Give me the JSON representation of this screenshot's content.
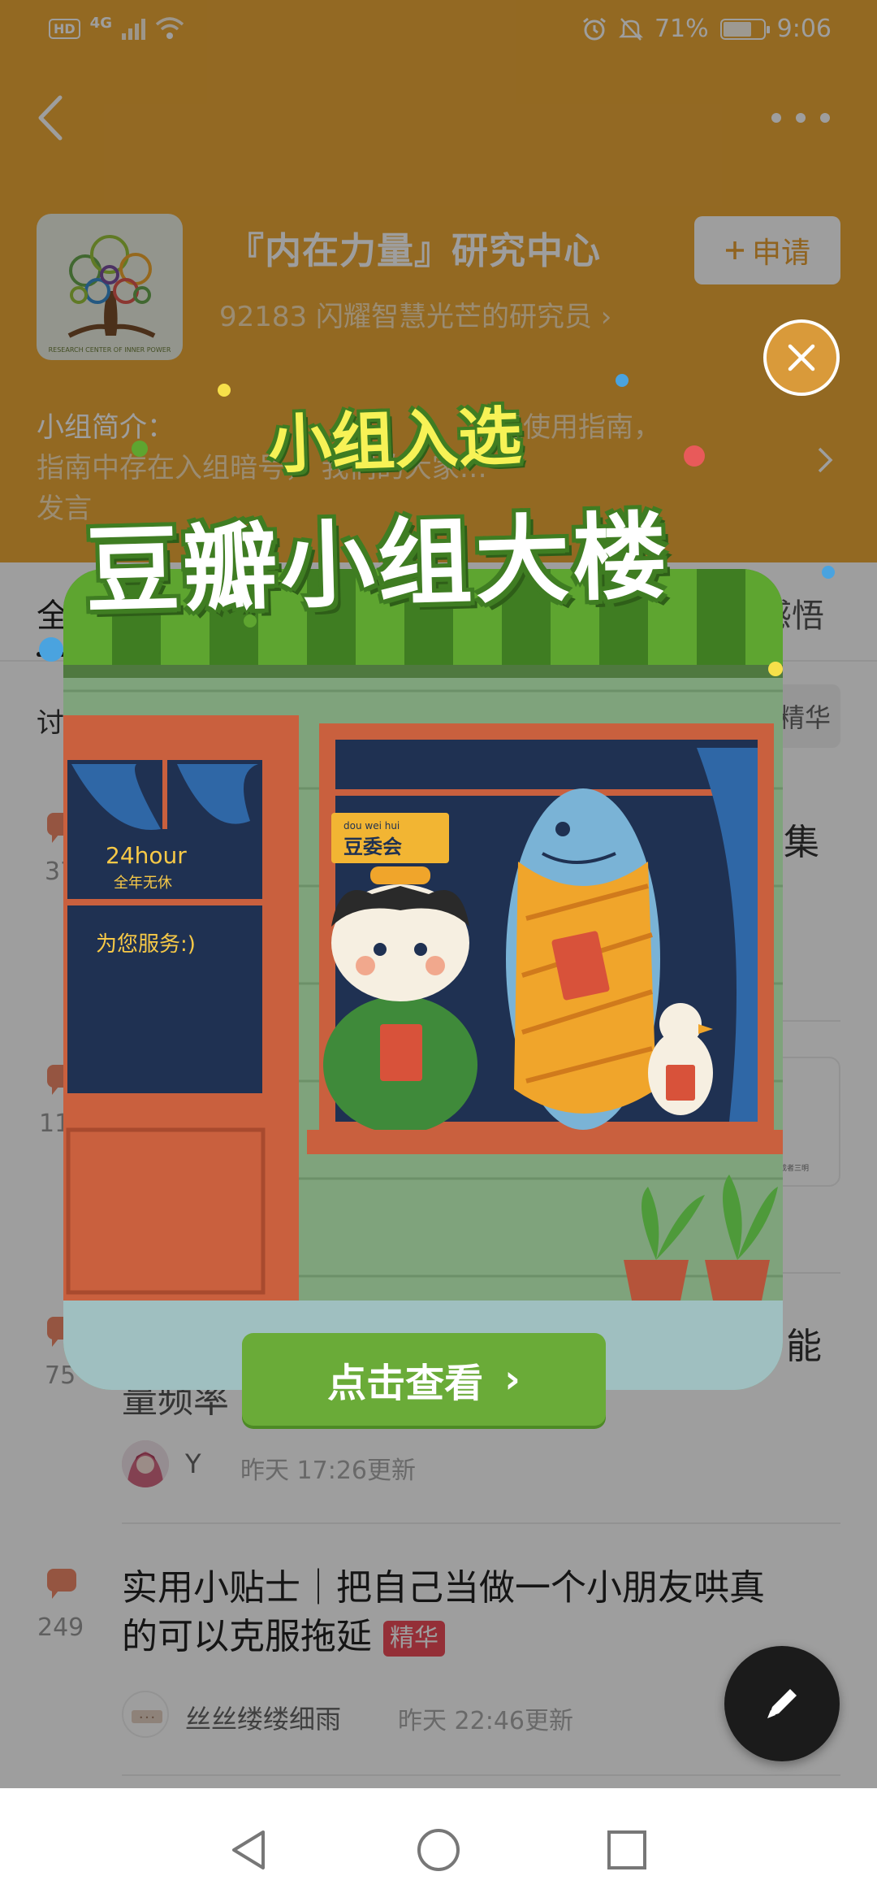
{
  "statusbar": {
    "network": "4G",
    "hd": "HD",
    "battery_pct": "71%",
    "battery_level": 0.71,
    "time": "9:06"
  },
  "group": {
    "title": "『内在力量』研究中心",
    "members_line": "92183 闪耀智慧光芒的研究员 ›",
    "apply_label": "申请",
    "intro_label": "小组简介：",
    "intro_lines": [
      "组使用指南，",
      "指南中存在入组暗号，            我们的大家…",
      "发言"
    ]
  },
  "tabs": {
    "active": "全部",
    "right": "及感悟"
  },
  "filters": {
    "left": "讨",
    "right": "精华"
  },
  "popup": {
    "headline_top": "小组入选",
    "headline_main": "豆瓣小组大楼",
    "shop_sign_pinyin": "dou wei hui",
    "shop_sign": "豆委会",
    "door_text_1": "24hour",
    "door_text_2": "全年无休",
    "door_text_3": "为您服务:)",
    "view_button": "点击查看",
    "view_chevron": "›"
  },
  "list": {
    "row1": {
      "count": "37",
      "peek_right": "集"
    },
    "row2": {
      "count": "11",
      "thumb_caption": "第成者三明"
    },
    "row3": {
      "count": "75",
      "peek_right": "能",
      "peek_left": "量频率",
      "author": "Y",
      "time": "昨天 17:26更新"
    },
    "row4": {
      "count": "249",
      "title_line1": "实用小贴士｜把自己当做一个小朋友哄真",
      "title_line2": "的可以克服拖延",
      "badge": "精华",
      "author": "丝丝缕缕细雨",
      "time": "昨天 22:46更新"
    }
  },
  "colors": {
    "header": "#eeaa38",
    "green": "#6aab38",
    "badge": "#ef4d5a",
    "comment": "#f08a6a"
  },
  "icons": [
    "back-icon",
    "more-icon",
    "plus-icon",
    "close-icon",
    "chevron-right-icon",
    "comment-icon",
    "pen-icon",
    "nav-back-icon",
    "nav-home-icon",
    "nav-recent-icon"
  ]
}
